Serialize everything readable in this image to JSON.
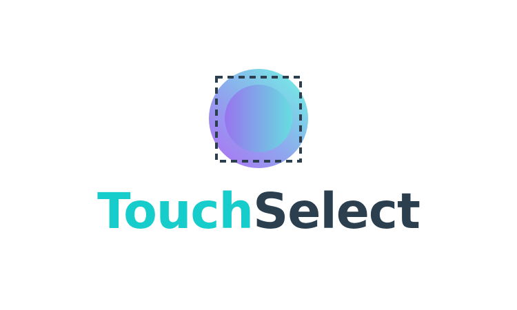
{
  "brand": {
    "word_primary": "Touch",
    "word_secondary": "Select",
    "colors": {
      "primary_word": "#16cdcc",
      "secondary_word": "#2c3f4f",
      "selection_frame": "#2c3f4f",
      "circle_gradient_start": "#b06cf4",
      "circle_gradient_end": "#6ff8e3"
    },
    "mark": {
      "icon": "gradient-circle-with-dashed-selection-square-icon"
    }
  }
}
